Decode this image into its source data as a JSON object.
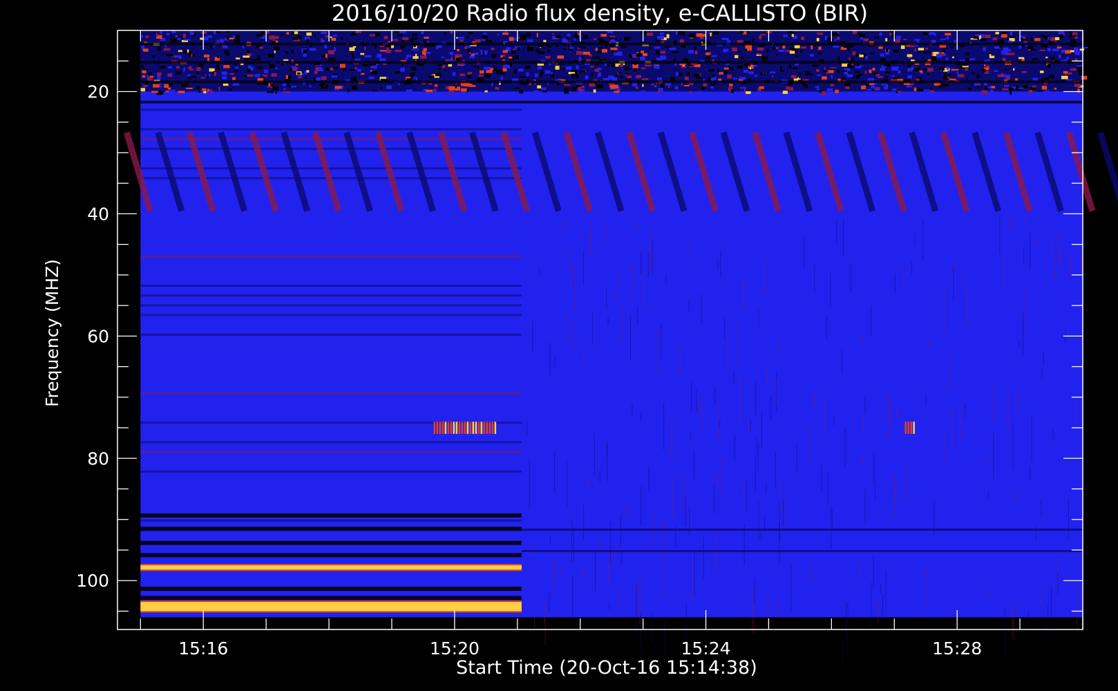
{
  "chart_data": {
    "type": "heatmap",
    "title": "2016/10/20  Radio flux density, e-CALLISTO (BIR)",
    "xlabel": "Start Time (20-Oct-16 15:14:38)",
    "ylabel": "Frequency (MHZ)",
    "x_major_ticks": [
      "15:16",
      "15:20",
      "15:24",
      "15:28"
    ],
    "y_major_ticks": [
      "20",
      "40",
      "60",
      "80",
      "100"
    ],
    "x_range": [
      "15:14:38",
      "15:30:00"
    ],
    "y_range_mhz": [
      10,
      108
    ],
    "y_axis_inverted": true,
    "data_extent": {
      "time_start": "15:15:00",
      "time_end": "15:30:00",
      "freq_low_mhz": 10,
      "freq_high_mhz": 106
    },
    "receiver_change_time": "15:21:04",
    "colormap": [
      "#000000",
      "#0a0a6e",
      "#2222ee",
      "#8a1a4a",
      "#e8401a",
      "#ffd040"
    ],
    "frame_color": "#ffffff",
    "background_color": "#000000",
    "features": [
      {
        "kind": "broadband_interference",
        "freq_mhz": [
          10,
          20
        ],
        "time": [
          "15:15:00",
          "15:30:00"
        ],
        "level": "high"
      },
      {
        "kind": "drifting_bands",
        "freq_mhz": [
          26,
          40
        ],
        "time": [
          "15:15:00",
          "15:30:00"
        ],
        "level": "medium"
      },
      {
        "kind": "strong_band",
        "freq_mhz": [
          97.5,
          98.2
        ],
        "time": [
          "15:15:00",
          "15:21:04"
        ],
        "level": "very_high"
      },
      {
        "kind": "strong_band",
        "freq_mhz": [
          103.5,
          105
        ],
        "time": [
          "15:15:00",
          "15:21:04"
        ],
        "level": "very_high"
      },
      {
        "kind": "burst",
        "freq_mhz": [
          74,
          76
        ],
        "time": [
          "15:19:40",
          "15:20:40"
        ],
        "level": "high"
      },
      {
        "kind": "burst",
        "freq_mhz": [
          74,
          76
        ],
        "time": [
          "15:27:10",
          "15:27:20"
        ],
        "level": "high"
      }
    ]
  }
}
